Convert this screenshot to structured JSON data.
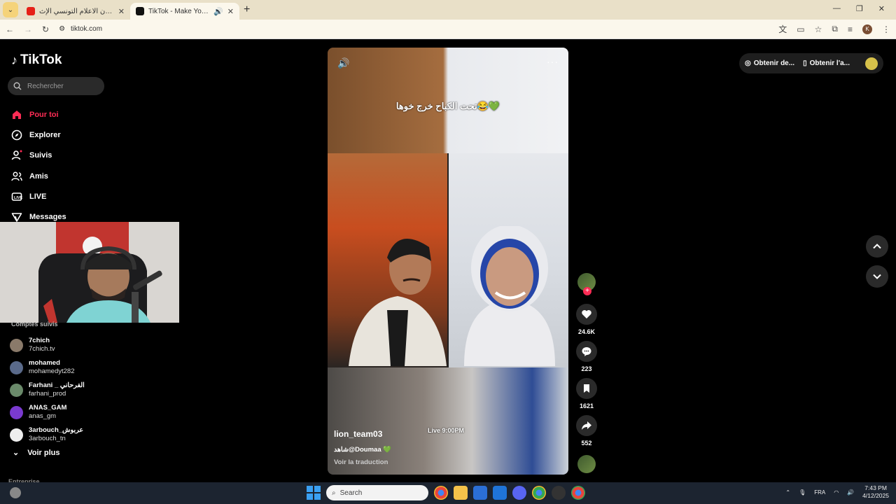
{
  "browser": {
    "tabs": [
      {
        "title": "الهدار و جنون الاعلام التونسي الإث...",
        "favicon_color": "#e62117",
        "active": false
      },
      {
        "title": "TikTok - Make Your Day",
        "favicon_color": "#111111",
        "active": true
      }
    ],
    "url": "tiktok.com"
  },
  "tiktok": {
    "logo": "TikTok",
    "search_placeholder": "Rechercher",
    "nav": [
      {
        "label": "Pour toi",
        "icon": "home-icon",
        "active": true
      },
      {
        "label": "Explorer",
        "icon": "compass-icon"
      },
      {
        "label": "Suivis",
        "icon": "following-icon"
      },
      {
        "label": "Amis",
        "icon": "friends-icon"
      },
      {
        "label": "LIVE",
        "icon": "live-icon"
      },
      {
        "label": "Messages",
        "icon": "messages-icon"
      }
    ],
    "followed_title": "Comptes suivis",
    "followed": [
      {
        "name": "7chich",
        "handle": "7chich.tv"
      },
      {
        "name": "mohamed",
        "handle": "mohamedyt282"
      },
      {
        "name": "Farhani _ الفرحاني",
        "handle": "farhani_prod"
      },
      {
        "name": "ANAS_GAM",
        "handle": "anas_gm"
      },
      {
        "name": "3arbouch_عربوش",
        "handle": "3arbouch_tn"
      }
    ],
    "see_more": "Voir plus",
    "footer_cut": "Entreprise",
    "top_right": {
      "get_coins": "Obtenir de...",
      "get_app": "Obtenir l'a..."
    }
  },
  "video": {
    "caption": "تحت الكباح خرج خوها😂💚",
    "overlay_live": "Live 9:00PM",
    "author": "lion_team03",
    "description": "شاهد@Doumaa",
    "description_heart": "💚",
    "translate": "Voir la traduction",
    "likes": "24.6K",
    "comments": "223",
    "saves": "1621",
    "shares": "552"
  },
  "taskbar": {
    "search_placeholder": "Search",
    "lang": "FRA",
    "time": "7:43 PM",
    "date": "4/12/2025"
  }
}
